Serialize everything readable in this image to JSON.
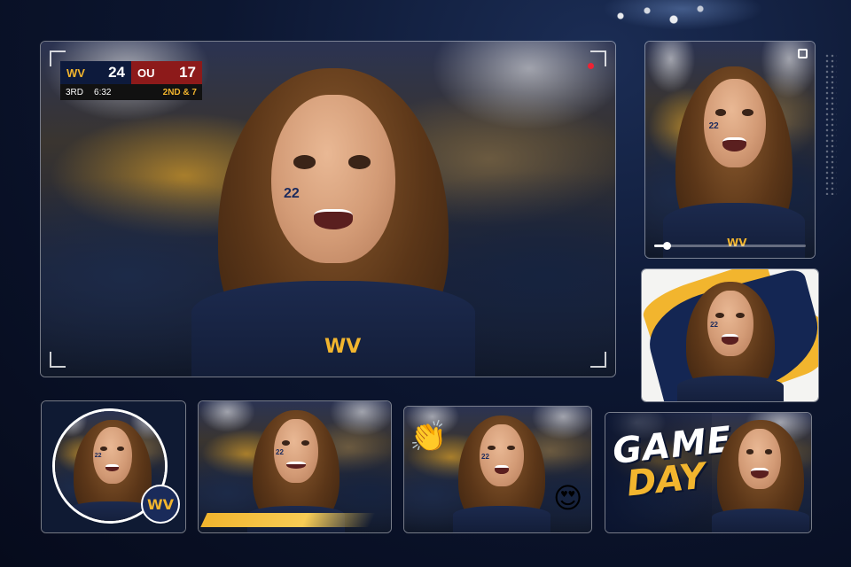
{
  "scoreboard": {
    "team1_logo": "WV",
    "team1_score": "24",
    "team2_logo": "OU",
    "team2_score": "17",
    "quarter": "3RD",
    "clock": "6:32",
    "down": "2ND & 7"
  },
  "fan": {
    "cheek_number": "22",
    "shirt_logo": "WV"
  },
  "video_progress": 0.08,
  "badge_logo": "WV",
  "gameday": {
    "line1": "GAME",
    "line2": "DAY"
  },
  "emojis": {
    "clap": "👏",
    "heart_eyes": "😍"
  },
  "icons": {
    "record": "record-dot-icon",
    "expand": "expand-icon"
  },
  "colors": {
    "gold": "#f2b52e",
    "navy": "#1a2b5a",
    "crimson": "#8d1a1a"
  }
}
